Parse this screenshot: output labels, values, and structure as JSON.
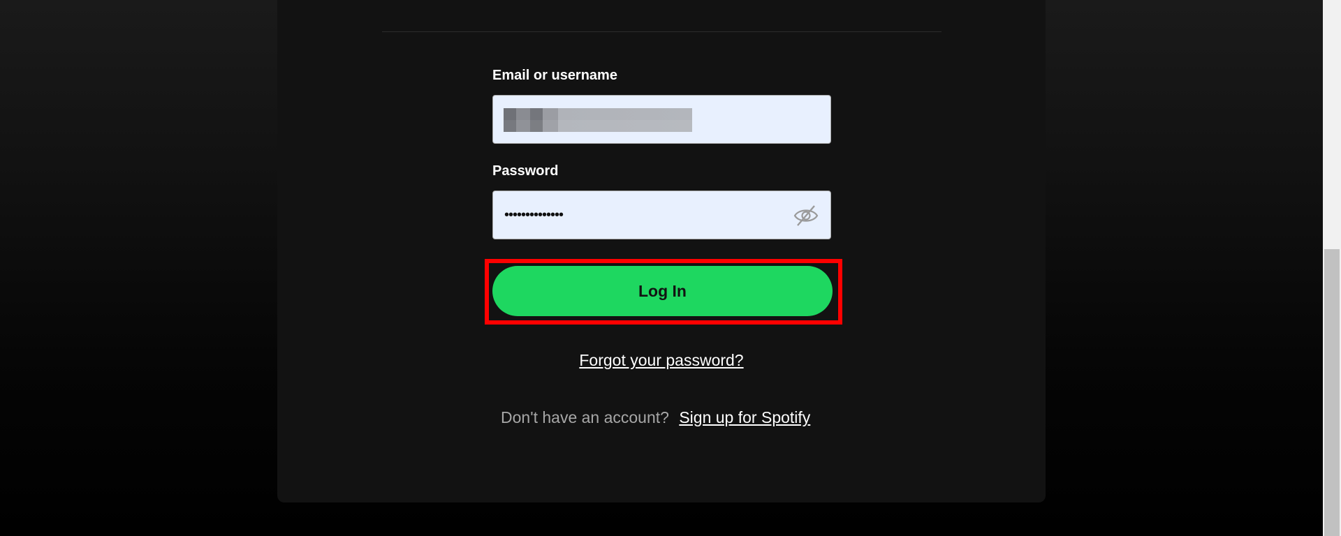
{
  "form": {
    "email_label": "Email or username",
    "password_label": "Password",
    "password_masked": "••••••••••••••",
    "password_visibility_icon": "eye-slash-icon",
    "login_label": "Log In",
    "forgot_label": "Forgot your password?",
    "signup_prompt": "Don't have an account?",
    "signup_label": "Sign up for Spotify"
  },
  "colors": {
    "brand_green": "#1ed760",
    "card_background": "#121212",
    "input_background": "#e8f0fe",
    "highlight_border": "#ff0000"
  }
}
